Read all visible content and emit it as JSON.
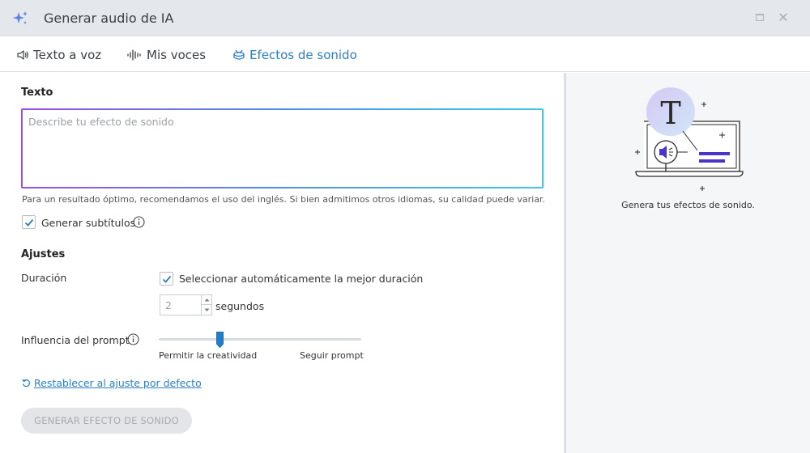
{
  "window": {
    "title": "Generar audio de IA",
    "controls": [
      "maximize",
      "close"
    ]
  },
  "tabs": [
    {
      "label": "Texto a voz",
      "icon": "speaker-icon",
      "active": false
    },
    {
      "label": "Mis voces",
      "icon": "waveform-icon",
      "active": false
    },
    {
      "label": "Efectos de sonido",
      "icon": "drum-icon",
      "active": true
    }
  ],
  "form": {
    "text_label": "Texto",
    "text_placeholder": "Describe tu efecto de sonido",
    "text_value": "",
    "hint": "Para un resultado óptimo, recomendamos el uso del inglés. Si bien admitimos otros idiomas, su calidad puede variar.",
    "subtitles_label": "Generar subtítulos",
    "subtitles_checked": true,
    "settings_title": "Ajustes",
    "duration_label": "Duración",
    "auto_duration_label": "Seleccionar automáticamente la mejor duración",
    "auto_duration_checked": true,
    "duration_value": "2",
    "duration_unit": "segundos",
    "prompt_influence_label": "Influencia del prompt",
    "slider_min_label": "Permitir la creatividad",
    "slider_max_label": "Seguir prompt",
    "slider_value": 0.3,
    "reset_label": "Restablecer al ajuste por defecto",
    "generate_button": "GENERAR EFECTO DE SONIDO"
  },
  "side": {
    "caption": "Genera tus efectos de sonido."
  },
  "colors": {
    "accent": "#2a7fc4",
    "gradient_start": "#9b4fe0",
    "gradient_end": "#3cc8e8",
    "illus_purple": "#4b35c8"
  }
}
